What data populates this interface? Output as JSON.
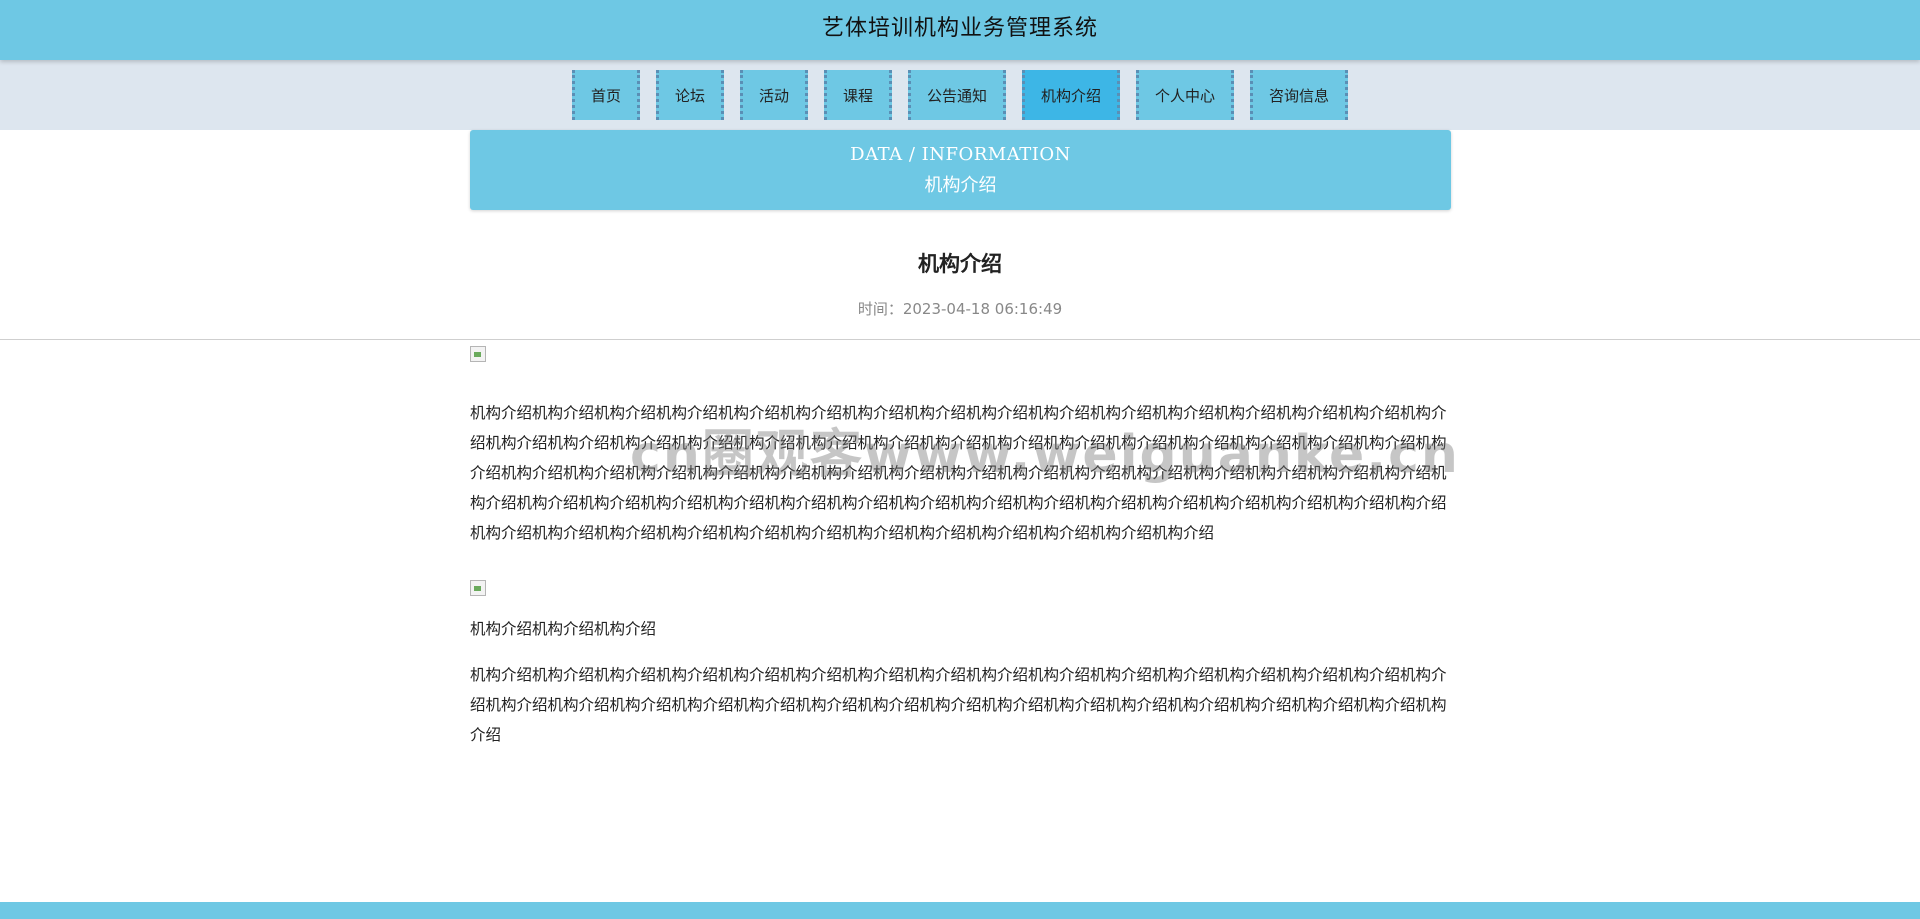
{
  "header": {
    "title": "艺体培训机构业务管理系统"
  },
  "nav": {
    "items": [
      {
        "label": "首页"
      },
      {
        "label": "论坛"
      },
      {
        "label": "活动"
      },
      {
        "label": "课程"
      },
      {
        "label": "公告通知"
      },
      {
        "label": "机构介绍",
        "active": true
      },
      {
        "label": "个人中心"
      },
      {
        "label": "咨询信息"
      }
    ]
  },
  "banner": {
    "subtitle_en": "DATA / INFORMATION",
    "subtitle_cn": "机构介绍"
  },
  "article": {
    "title": "机构介绍",
    "time": "时间：2023-04-18 06:16:49",
    "paragraph1": "机构介绍机构介绍机构介绍机构介绍机构介绍机构介绍机构介绍机构介绍机构介绍机构介绍机构介绍机构介绍机构介绍机构介绍机构介绍机构介绍机构介绍机构介绍机构介绍机构介绍机构介绍机构介绍机构介绍机构介绍机构介绍机构介绍机构介绍机构介绍机构介绍机构介绍机构介绍机构介绍机构介绍机构介绍机构介绍机构介绍机构介绍机构介绍机构介绍机构介绍机构介绍机构介绍机构介绍机构介绍机构介绍机构介绍机构介绍机构介绍机构介绍机构介绍机构介绍机构介绍机构介绍机构介绍机构介绍机构介绍机构介绍机构介绍机构介绍机构介绍机构介绍机构介绍机构介绍机构介绍机构介绍机构介绍机构介绍机构介绍机构介绍机构介绍机构介绍机构介绍机构介绍机构介绍机构介绍",
    "paragraph2": "机构介绍机构介绍机构介绍",
    "paragraph3": "机构介绍机构介绍机构介绍机构介绍机构介绍机构介绍机构介绍机构介绍机构介绍机构介绍机构介绍机构介绍机构介绍机构介绍机构介绍机构介绍机构介绍机构介绍机构介绍机构介绍机构介绍机构介绍机构介绍机构介绍机构介绍机构介绍机构介绍机构介绍机构介绍机构介绍机构介绍机构介绍"
  },
  "watermark": {
    "text": "cn圈观客www.weiguanke.cn"
  },
  "colors": {
    "primary": "#6ec8e4",
    "active": "#3db6e6",
    "nav_bg": "#dde6ef"
  }
}
